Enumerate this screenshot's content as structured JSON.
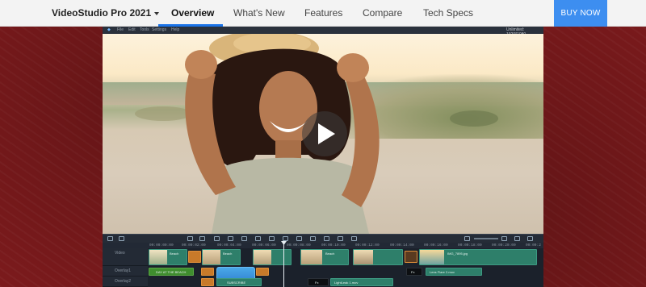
{
  "nav": {
    "brand": "VideoStudio Pro 2021",
    "links": [
      "Overview",
      "What's New",
      "Features",
      "Compare",
      "Tech Specs"
    ],
    "active": "Overview",
    "buy_label": "BUY NOW"
  },
  "app": {
    "menu": [
      "File",
      "Edit",
      "Tools",
      "Settings",
      "Help"
    ],
    "project_label": "Unlimited: 1920*1080",
    "ruler": [
      "00:00:00:00",
      "00:00:02:00",
      "00:00:04:00",
      "00:00:06:00",
      "00:00:08:00",
      "00:00:10:00",
      "00:00:12:00",
      "00:00:14:00",
      "00:00:16:00",
      "00:00:18:00",
      "00:00:20:00",
      "00:00:2"
    ],
    "tracks": [
      {
        "name": "Video"
      },
      {
        "name": "Overlay1"
      },
      {
        "name": "Overlay2"
      }
    ],
    "clips": {
      "v1": "Beach",
      "v2": "Beach",
      "v3": "Beach",
      "v4": "IMG_7895.jpg",
      "o1": "DAY AT THE BEACH",
      "o1b": "Lens Flare 2.mov",
      "o2": "SUBSCRIBE",
      "o2b": "LightLeak 1.mov",
      "fx": "Fx"
    }
  },
  "colors": {
    "accent": "#1a73e8",
    "buy": "#3d8ef0",
    "background": "#7b1a1c"
  }
}
